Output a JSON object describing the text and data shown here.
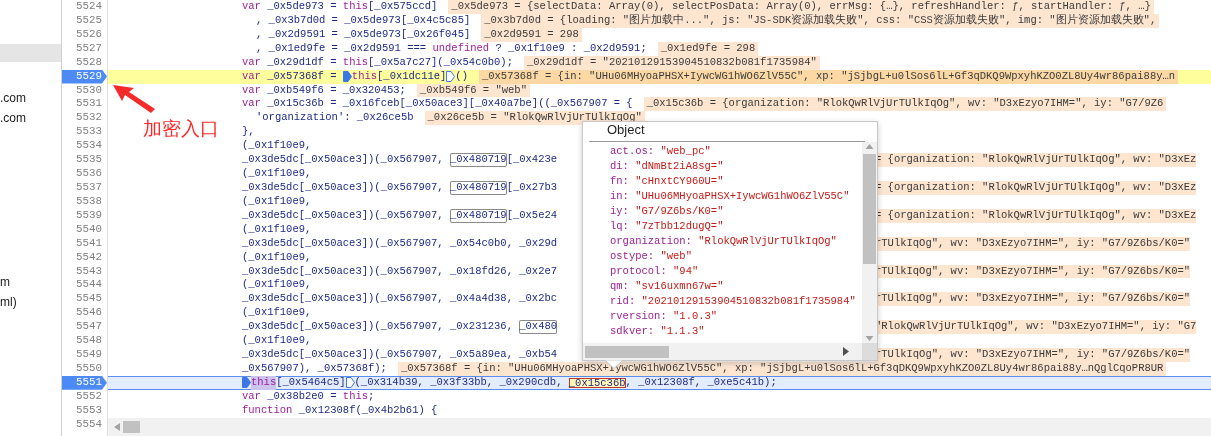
{
  "sidebar": {
    "items": [
      {
        "selected": true
      },
      {
        "label": ".com",
        "selected": false
      },
      {
        "label": ".com",
        "selected": false
      },
      {
        "label": "m",
        "selected": false
      },
      {
        "label": "ml)",
        "selected": false
      }
    ]
  },
  "annotation": {
    "text": "加密入口"
  },
  "lines": [
    {
      "number": "5524",
      "kind": "statement",
      "breakpoint": false,
      "code": [
        {
          "kind": "keyword",
          "text": "var"
        },
        {
          "kind": "plain",
          "text": " _0x5de973 = "
        },
        {
          "kind": "keyword",
          "text": "this"
        },
        {
          "kind": "plain",
          "text": "[_0x575ccd]"
        }
      ],
      "value": "_0x5de973 = {selectData: Array(0), selectPosData: Array(0), errMsg: {…}, refreshHandler: ƒ, startHandler: ƒ, …}"
    },
    {
      "number": "5525",
      "kind": "continuation",
      "breakpoint": false,
      "code": [
        {
          "kind": "plain",
          "text": ", _0x3b7d0d = _0x5de973[_0x4c5c85]"
        }
      ],
      "value": "_0x3b7d0d = {loading: \"图片加载中...\", js: \"JS-SDK资源加载失败\", css: \"CSS资源加载失败\", img: \"图片资源加载失败\","
    },
    {
      "number": "5526",
      "kind": "continuation",
      "breakpoint": false,
      "code": [
        {
          "kind": "plain",
          "text": ", _0x2d9591 = _0x5de973[_0x26f045]"
        }
      ],
      "value": "_0x2d9591 = 298"
    },
    {
      "number": "5527",
      "kind": "continuation",
      "breakpoint": false,
      "code": [
        {
          "kind": "plain",
          "text": ", _0x1ed9fe = _0x2d9591 === "
        },
        {
          "kind": "keyword",
          "text": "undefined"
        },
        {
          "kind": "plain",
          "text": " ? _0x1f10e9 : _0x2d9591;"
        }
      ],
      "value": "_0x1ed9fe = 298"
    },
    {
      "number": "5528",
      "kind": "statement",
      "breakpoint": false,
      "code": [
        {
          "kind": "keyword",
          "text": "var"
        },
        {
          "kind": "plain",
          "text": " _0x29d1df = "
        },
        {
          "kind": "keyword",
          "text": "this"
        },
        {
          "kind": "plain",
          "text": "[_0x5a7c27](_0x54c0b0);"
        }
      ],
      "value": "_0x29d1df = \"20210129153904510832b081f1735984\""
    },
    {
      "number": "5529",
      "kind": "statement",
      "breakpoint": true,
      "paused": true,
      "code": [
        {
          "kind": "keyword",
          "text": "var"
        },
        {
          "kind": "plain",
          "text": " _0x57368f = "
        },
        {
          "kind": "marker-filled"
        },
        {
          "kind": "keyword",
          "text": "this"
        },
        {
          "kind": "plain",
          "text": "[_0x1dc11e]"
        },
        {
          "kind": "marker-outline"
        },
        {
          "kind": "plain",
          "text": "()"
        }
      ],
      "value": "_0x57368f = {in: \"UHu06MHyoaPHSX+IywcWG1hWO6ZlV55C\", xp: \"jSjbgL+u0lSos6lL+Gf3qDKQ9WpxyhKZO0ZL8Uy4wr86pai88y…n"
    },
    {
      "number": "5530",
      "kind": "statement",
      "breakpoint": false,
      "code": [
        {
          "kind": "keyword",
          "text": "var"
        },
        {
          "kind": "plain",
          "text": " _0xb549f6 = _0x320453;"
        }
      ],
      "value": "_0xb549f6 = \"web\""
    },
    {
      "number": "5531",
      "kind": "statement",
      "breakpoint": false,
      "code": [
        {
          "kind": "keyword",
          "text": "var"
        },
        {
          "kind": "plain",
          "text": " _0x15c36b = _0x16fceb[_0x50ace3][_0x40a7be]((_0x567907 = {"
        }
      ],
      "value": "_0x15c36b = {organization: \"RlokQwRlVjUrTUlkIqOg\", wv: \"D3xEzyo7IHM=\", iy: \"G7/9Z6"
    },
    {
      "number": "5532",
      "kind": "continuation",
      "breakpoint": false,
      "code": [
        {
          "kind": "plain",
          "text": "'organization': _0x26ce5b"
        }
      ],
      "value": "_0x26ce5b = \"RlokQwRlVjUrTUlkIqOg\""
    },
    {
      "number": "5533",
      "kind": "statement",
      "breakpoint": false,
      "code": [
        {
          "kind": "plain",
          "text": "},"
        }
      ]
    },
    {
      "number": "5534",
      "kind": "statement",
      "breakpoint": false,
      "code": [
        {
          "kind": "plain",
          "text": "(_0x1f10e9,"
        }
      ]
    },
    {
      "number": "5535",
      "kind": "statement",
      "breakpoint": false,
      "code": [
        {
          "kind": "plain",
          "text": "_0x3de5dc[_0x50ace3])(_0x567907, "
        },
        {
          "kind": "boxed",
          "text": "_0x480719"
        },
        {
          "kind": "plain",
          "text": "[_0x423e"
        }
      ],
      "value_after_popup": "= {organization: \"RlokQwRlVjUrTUlkIqOg\", wv: \"D3xEz"
    },
    {
      "number": "5536",
      "kind": "statement",
      "breakpoint": false,
      "code": [
        {
          "kind": "plain",
          "text": "(_0x1f10e9,"
        }
      ]
    },
    {
      "number": "5537",
      "kind": "statement",
      "breakpoint": false,
      "code": [
        {
          "kind": "plain",
          "text": "_0x3de5dc[_0x50ace3])(_0x567907, "
        },
        {
          "kind": "boxed",
          "text": "_0x480719"
        },
        {
          "kind": "plain",
          "text": "[_0x27b3"
        }
      ],
      "value_after_popup": "= {organization: \"RlokQwRlVjUrTUlkIqOg\", wv: \"D3xEz"
    },
    {
      "number": "5538",
      "kind": "statement",
      "breakpoint": false,
      "code": [
        {
          "kind": "plain",
          "text": "(_0x1f10e9,"
        }
      ]
    },
    {
      "number": "5539",
      "kind": "statement",
      "breakpoint": false,
      "code": [
        {
          "kind": "plain",
          "text": "_0x3de5dc[_0x50ace3])(_0x567907, "
        },
        {
          "kind": "boxed",
          "text": "_0x480719"
        },
        {
          "kind": "plain",
          "text": "[_0x5e24"
        }
      ],
      "value_after_popup": "= {organization: \"RlokQwRlVjUrTUlkIqOg\", wv: \"D3xEz"
    },
    {
      "number": "5540",
      "kind": "statement",
      "breakpoint": false,
      "code": [
        {
          "kind": "plain",
          "text": "(_0x1f10e9,"
        }
      ]
    },
    {
      "number": "5541",
      "kind": "statement",
      "breakpoint": false,
      "code": [
        {
          "kind": "plain",
          "text": "_0x3de5dc[_0x50ace3])(_0x567907, _0x54c0b0, _0x29d"
        }
      ],
      "value_after_popup": "rTUlkIqOg\", wv: \"D3xEzyo7IHM=\", iy: \"G7/9Z6bs/K0=\""
    },
    {
      "number": "5542",
      "kind": "statement",
      "breakpoint": false,
      "code": [
        {
          "kind": "plain",
          "text": "(_0x1f10e9,"
        }
      ]
    },
    {
      "number": "5543",
      "kind": "statement",
      "breakpoint": false,
      "code": [
        {
          "kind": "plain",
          "text": "_0x3de5dc[_0x50ace3])(_0x567907, _0x18fd26, _0x2e7"
        }
      ],
      "value_after_popup": "rTUlkIqOg\", wv: \"D3xEzyo7IHM=\", iy: \"G7/9Z6bs/K0=\""
    },
    {
      "number": "5544",
      "kind": "statement",
      "breakpoint": false,
      "code": [
        {
          "kind": "plain",
          "text": "(_0x1f10e9,"
        }
      ]
    },
    {
      "number": "5545",
      "kind": "statement",
      "breakpoint": false,
      "code": [
        {
          "kind": "plain",
          "text": "_0x3de5dc[_0x50ace3])(_0x567907, _0x4a4d38, _0x2bc"
        }
      ],
      "value_after_popup": "rTUlkIqOg\", wv: \"D3xEzyo7IHM=\", iy: \"G7/9Z6bs/K0=\""
    },
    {
      "number": "5546",
      "kind": "statement",
      "breakpoint": false,
      "code": [
        {
          "kind": "plain",
          "text": "(_0x1f10e9,"
        }
      ]
    },
    {
      "number": "5547",
      "kind": "statement",
      "breakpoint": false,
      "code": [
        {
          "kind": "plain",
          "text": "_0x3de5dc[_0x50ace3])(_0x567907, _0x231236, "
        },
        {
          "kind": "boxed",
          "text": "_0x480"
        }
      ],
      "value_after_popup": "\"RlokQwRlVjUrTUlkIqOg\", wv: \"D3xEzyo7IHM=\", iy: \"G7"
    },
    {
      "number": "5548",
      "kind": "statement",
      "breakpoint": false,
      "code": [
        {
          "kind": "plain",
          "text": "(_0x1f10e9,"
        }
      ]
    },
    {
      "number": "5549",
      "kind": "statement",
      "breakpoint": false,
      "code": [
        {
          "kind": "plain",
          "text": "_0x3de5dc[_0x50ace3])(_0x567907, _0x5a89ea, _0xb54"
        }
      ],
      "value_after_popup": "rTUlkIqOg\", wv: \"D3xEzyo7IHM=\", iy: \"G7/9Z6bs/K0=\""
    },
    {
      "number": "5550",
      "kind": "statement",
      "breakpoint": false,
      "code": [
        {
          "kind": "plain",
          "text": "_0x567907), _0x57368f);"
        }
      ],
      "value": "_0x57368f = {in: \"UHu06MHyoaPHSX+IywcWG1hWO6ZlV55C\", xp: \"jSjbgL+u0lSos6lL+Gf3qDKQ9WpxyhKZO0ZL8Uy4wr86pai88y…nQglCqoPR8UR"
    },
    {
      "number": "5551",
      "kind": "statement",
      "breakpoint": true,
      "current": true,
      "code": [
        {
          "kind": "marker-filled"
        },
        {
          "kind": "selected-keyword",
          "text": "this"
        },
        {
          "kind": "plain",
          "text": "[_0x5464c5]"
        },
        {
          "kind": "marker-outline"
        },
        {
          "kind": "plain",
          "text": "(_0x314b39, _0x3f33bb, _0x290cdb, "
        },
        {
          "kind": "focused",
          "text": "_0x15c36b"
        },
        {
          "kind": "plain",
          "text": ", _0x12308f, _0xe5c41b);"
        }
      ]
    },
    {
      "number": "5552",
      "kind": "statement",
      "breakpoint": false,
      "code": [
        {
          "kind": "keyword",
          "text": "var"
        },
        {
          "kind": "plain",
          "text": " _0x38b2e0 = "
        },
        {
          "kind": "keyword",
          "text": "this"
        },
        {
          "kind": "plain",
          "text": ";"
        }
      ]
    },
    {
      "number": "5553",
      "kind": "statement",
      "breakpoint": false,
      "code": [
        {
          "kind": "keyword",
          "text": "function"
        },
        {
          "kind": "plain",
          "text": " _0x12308f(_0x4b2b61) {"
        }
      ]
    },
    {
      "number": "5554",
      "breakpoint": false
    }
  ],
  "popup": {
    "title": "Object",
    "properties": [
      {
        "key": "act.os:",
        "value": "\"web_pc\""
      },
      {
        "key": "di:",
        "value": "\"dNmBt2iA8sg=\""
      },
      {
        "key": "fn:",
        "value": "\"cHnxtCY960U=\""
      },
      {
        "key": "in:",
        "value": "\"UHu06MHyoaPHSX+IywcWG1hWO6ZlV55C\""
      },
      {
        "key": "iy:",
        "value": "\"G7/9Z6bs/K0=\""
      },
      {
        "key": "lq:",
        "value": "\"7zTbb12dugQ=\""
      },
      {
        "key": "organization:",
        "value": "\"RlokQwRlVjUrTUlkIqOg\""
      },
      {
        "key": "ostype:",
        "value": "\"web\""
      },
      {
        "key": "protocol:",
        "value": "\"94\""
      },
      {
        "key": "qm:",
        "value": "\"sv16uxmn67w=\""
      },
      {
        "key": "rid:",
        "value": "\"20210129153904510832b081f1735984\""
      },
      {
        "key": "rversion:",
        "value": "\"1.0.3\""
      },
      {
        "key": "sdkver:",
        "value": "\"1.1.3\""
      }
    ]
  }
}
